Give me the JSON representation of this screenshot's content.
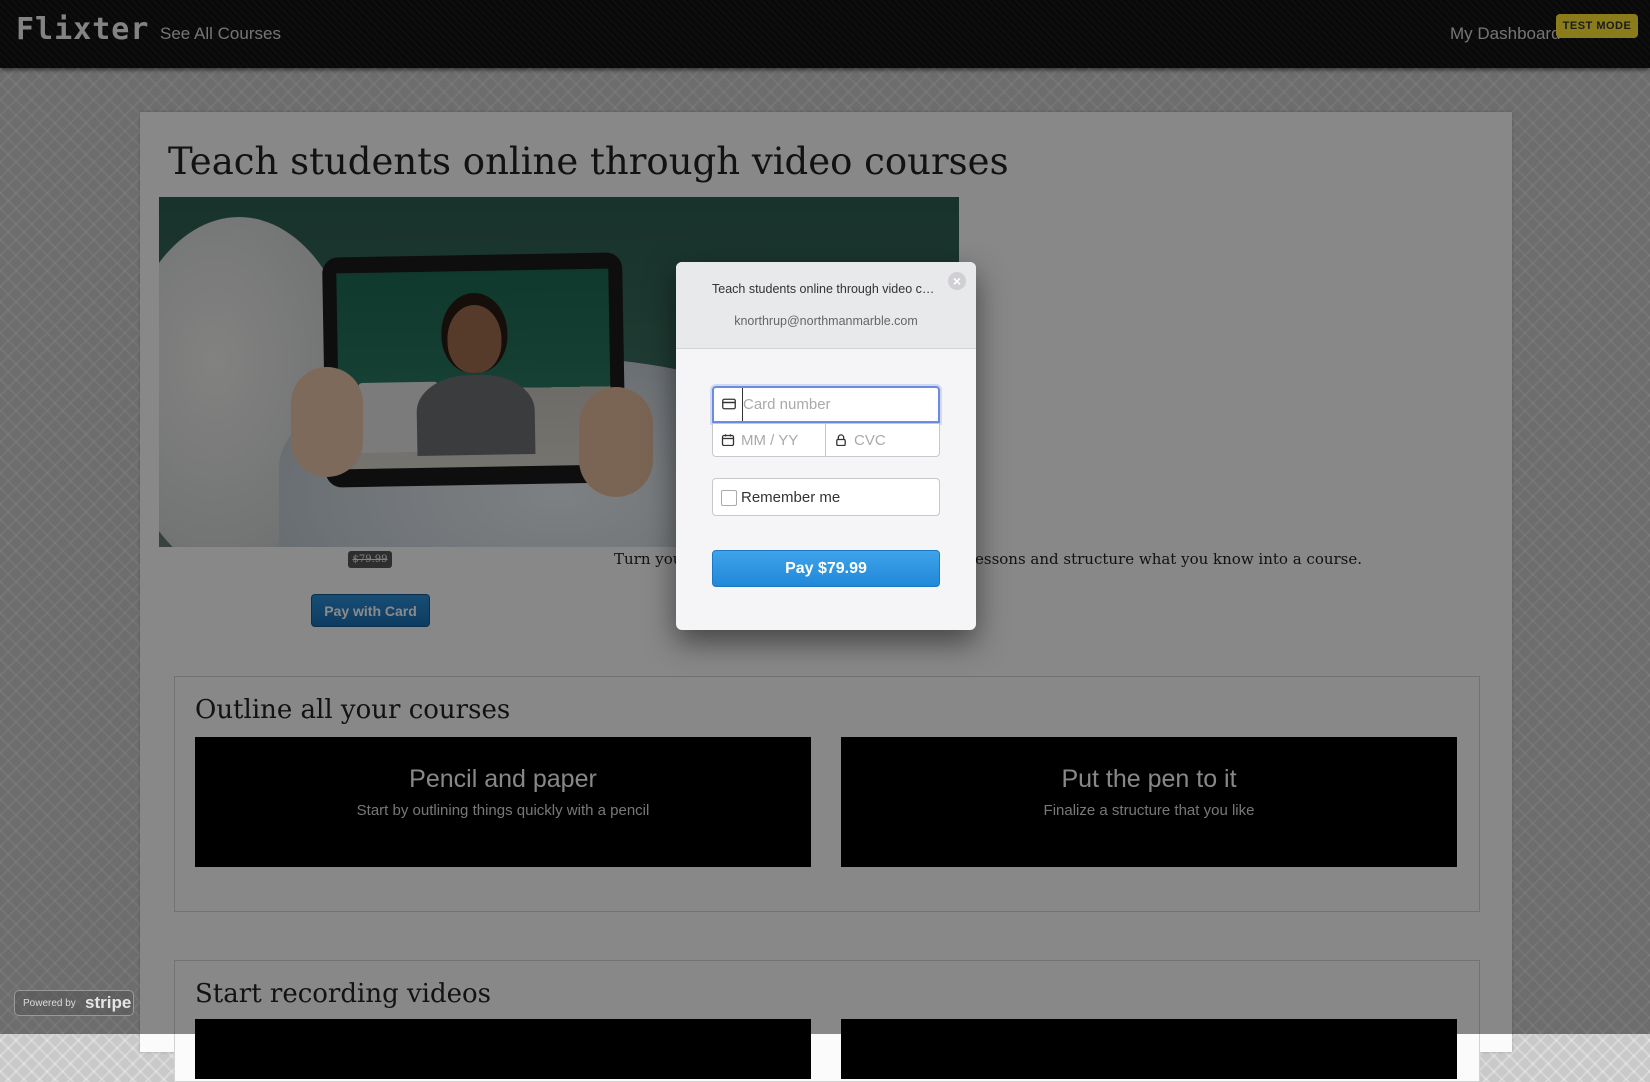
{
  "nav": {
    "brand": "Flixter",
    "see_all_courses": "See All Courses",
    "my_dashboard": "My Dashboard",
    "test_mode": "TEST MODE"
  },
  "course": {
    "title": "Teach students online through video courses",
    "price": "$79.99",
    "pay_button": "Pay with Card",
    "description_start": "Turn you",
    "description_end": "essons and structure what you know into a course."
  },
  "sections": [
    {
      "title": "Outline all your courses",
      "tiles": [
        {
          "title": "Pencil and paper",
          "subtitle": "Start by outlining things quickly with a pencil"
        },
        {
          "title": "Put the pen to it",
          "subtitle": "Finalize a structure that you like"
        }
      ]
    },
    {
      "title": "Start recording videos",
      "tiles": []
    }
  ],
  "checkout": {
    "title": "Teach students online through video courses",
    "email": "knorthrup@northmanmarble.com",
    "card_placeholder": "Card number",
    "expiry_placeholder": "MM / YY",
    "cvc_placeholder": "CVC",
    "remember_label": "Remember me",
    "pay_label": "Pay $79.99",
    "close_symbol": "×"
  },
  "footer": {
    "powered_by": "Powered by",
    "stripe": "stripe"
  },
  "colors": {
    "accent_blue": "#2188d8",
    "test_mode_yellow": "#ffe633",
    "focus_border": "#6c8be0"
  },
  "icons": {
    "card": "credit-card-icon",
    "calendar": "calendar-icon",
    "lock": "lock-icon",
    "close": "close-icon"
  }
}
